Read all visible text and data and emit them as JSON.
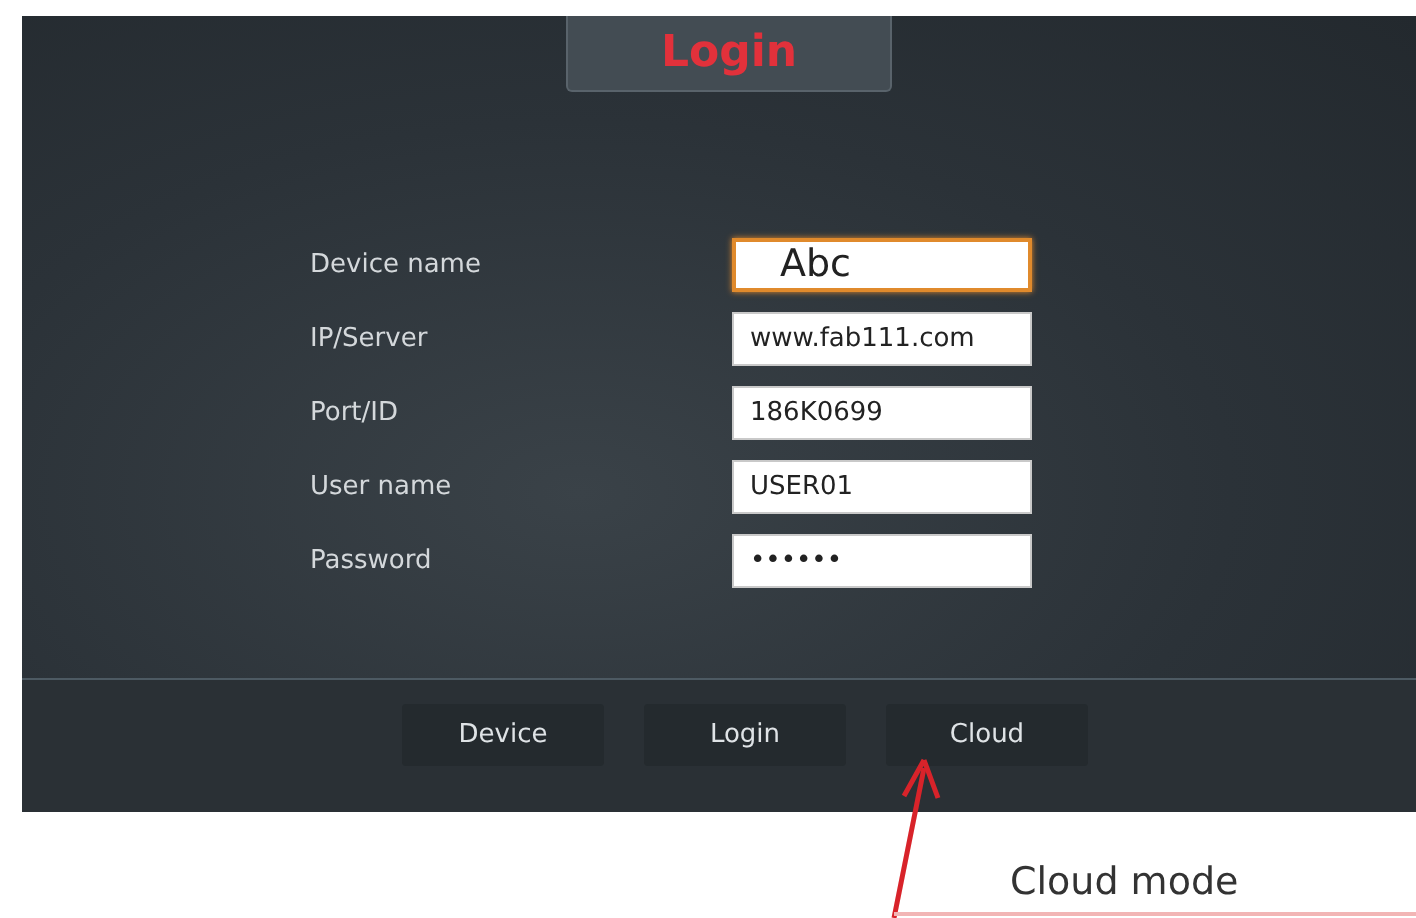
{
  "title": "Login",
  "fields": [
    {
      "label": "Device name",
      "value": "Abc",
      "focused": true
    },
    {
      "label": "IP/Server",
      "value": "www.fab111.com",
      "focused": false
    },
    {
      "label": "Port/ID",
      "value": "186K0699",
      "focused": false
    },
    {
      "label": "User name",
      "value": "USER01",
      "focused": false
    },
    {
      "label": "Password",
      "value": "••••••",
      "focused": false
    }
  ],
  "nav_buttons": [
    {
      "label": "Device"
    },
    {
      "label": "Login"
    },
    {
      "label": "Cloud"
    }
  ],
  "annotation": {
    "text": "Cloud mode"
  }
}
